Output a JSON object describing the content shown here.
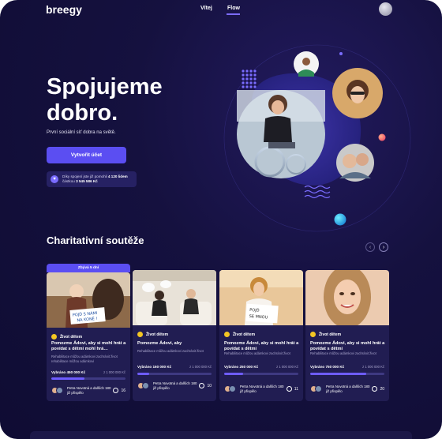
{
  "header": {
    "logo": "breegy",
    "nav": [
      {
        "label": "Vítej"
      },
      {
        "label": "Flow"
      }
    ]
  },
  "hero": {
    "title": "Spojujeme dobro.",
    "subtitle": "První sociální síť dobra na světě.",
    "cta_label": "Vytvořit účet",
    "impact_line1": "Díky spojení jste již pomohli",
    "impact_count": "4 120 lidem",
    "impact_line2": "částkou",
    "impact_amount": "3 545 586 Kč"
  },
  "section": {
    "title": "Charitativní soutěže"
  },
  "cards": [
    {
      "badge": "Zbývá 5 dní",
      "category": "Život dětem",
      "title": "Pomozme Ádovi, aby si mohl hrát a povídat s dětmi mohl hrá…",
      "description": "Rehabilitace můžou adámkovi zachránit život rehabilitace můžou adámkovi",
      "raised": "Vybráno 450 000 Kč",
      "goal": "z 1 000 000 Kč",
      "progress": 0.45,
      "supporters": "Petra Novotná a dalších 180 již přispělo",
      "comments": "16",
      "image_sign": "POJĎ S NÁMI NA KONĚ !"
    },
    {
      "category": "Život dětem",
      "title": "Pomozme Ádovi, aby",
      "description": "Rehabilitace můžou adámkovi zachránit život",
      "raised": "Vybráno 160 000 Kč",
      "goal": "z 1 000 000 Kč",
      "progress": 0.16,
      "supporters": "Petra Novotná a dalších 180 již přispělo",
      "comments": "10"
    },
    {
      "category": "Život dětem",
      "title": "Pomozme Ádovi, aby si mohl hrát a povídat s dětmi",
      "description": "Rehabilitace můžou adámkovi zachránit život",
      "raised": "Vybráno 250 000 Kč",
      "goal": "z 1 000 000 Kč",
      "progress": 0.25,
      "supporters": "Petra Novotná a dalších 180 již přispělo",
      "comments": "11",
      "image_sign": "POJĎ SE MNOU"
    },
    {
      "category": "Život dětem",
      "title": "Pomozme Ádovi, aby si mohl hrát a povídat s dětmi",
      "description": "Rehabilitace můžou adámkovi zachránit život",
      "raised": "Vybráno 750 000 Kč",
      "goal": "z 1 000 000 Kč",
      "progress": 0.75,
      "supporters": "Petra Novotná a dalších 180 již přispělo",
      "comments": "20"
    }
  ],
  "colors": {
    "accent": "#5b4ef2",
    "background": "#15113f",
    "category_dot": "#f3c623"
  }
}
